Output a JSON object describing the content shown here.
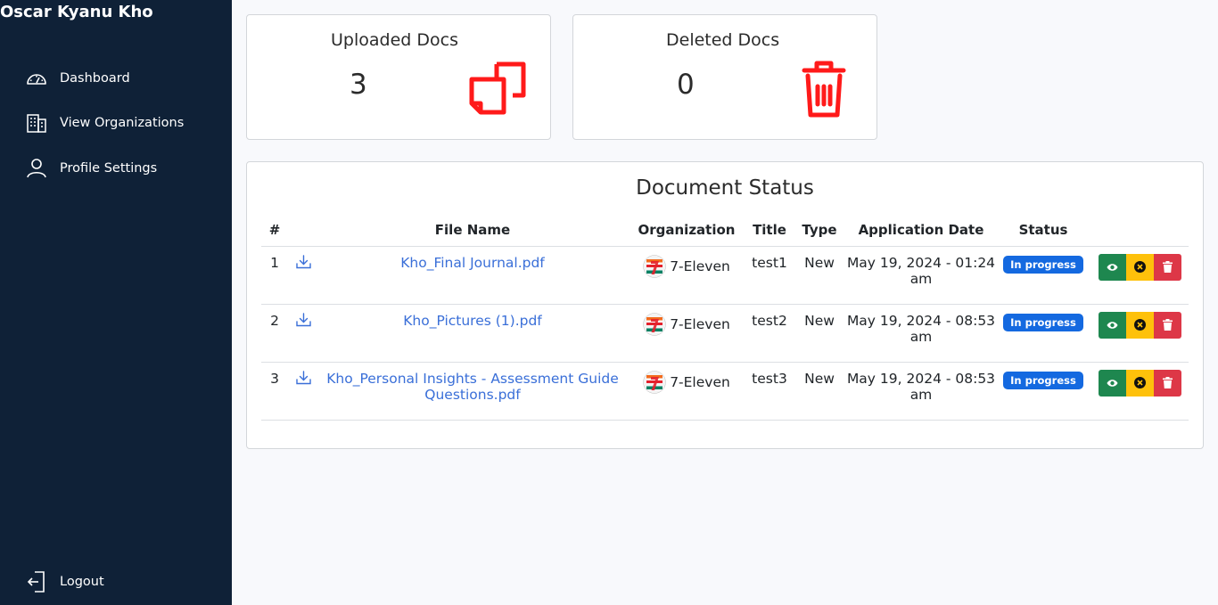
{
  "app": {
    "user_name": "Oscar Kyanu Kho"
  },
  "sidebar": {
    "items": [
      {
        "label": "Dashboard",
        "icon": "dashboard-gauge-icon"
      },
      {
        "label": "View Organizations",
        "icon": "building-icon"
      },
      {
        "label": "Profile Settings",
        "icon": "person-icon"
      }
    ],
    "logout": {
      "label": "Logout",
      "icon": "logout-icon"
    }
  },
  "stats": {
    "uploaded": {
      "title": "Uploaded Docs",
      "value": "3",
      "icon": "files-icon"
    },
    "deleted": {
      "title": "Deleted Docs",
      "value": "0",
      "icon": "trash-icon"
    }
  },
  "document_status": {
    "title": "Document Status",
    "columns": [
      "#",
      "File Name",
      "Organization",
      "Title",
      "Type",
      "Application Date",
      "Status"
    ],
    "rows": [
      {
        "num": "1",
        "file": "Kho_Final Journal.pdf",
        "org": "7-Eleven",
        "title": "test1",
        "type": "New",
        "date": "May 19, 2024 - 01:24 am",
        "status": "In progress"
      },
      {
        "num": "2",
        "file": "Kho_Pictures (1).pdf",
        "org": "7-Eleven",
        "title": "test2",
        "type": "New",
        "date": "May 19, 2024 - 08:53 am",
        "status": "In progress"
      },
      {
        "num": "3",
        "file": "Kho_Personal Insights - Assessment Guide Questions.pdf",
        "org": "7-Eleven",
        "title": "test3",
        "type": "New",
        "date": "May 19, 2024 - 08:53 am",
        "status": "In progress"
      }
    ]
  },
  "colors": {
    "sidebar_bg": "#0f2137",
    "accent_red": "#ff1a1a",
    "link_blue": "#3a6fd8",
    "badge_blue": "#1469e0",
    "btn_green": "#1e874f",
    "btn_yellow": "#fec10b",
    "btn_red": "#dd3747"
  }
}
